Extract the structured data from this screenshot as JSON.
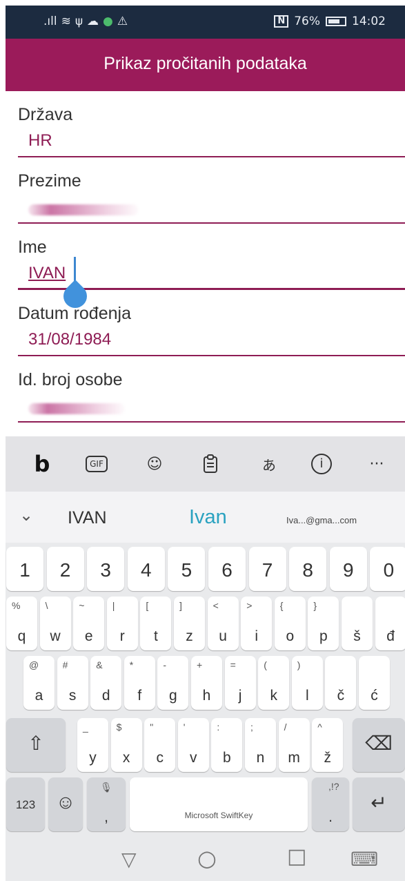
{
  "status_bar": {
    "signal": ".ıll",
    "wifi": "≋",
    "usb": "ψ",
    "cloud": "☁",
    "dot": "●",
    "warning": "⚠",
    "nfc": "N",
    "battery_percent": "76%",
    "time": "14:02"
  },
  "title": "Prikaz pročitanih podataka",
  "fields": [
    {
      "label": "Država",
      "value": "HR"
    },
    {
      "label": "Prezime",
      "value": ""
    },
    {
      "label": "Ime",
      "value": "IVAN"
    },
    {
      "label": "Datum rođenja",
      "value": "31/08/1984"
    },
    {
      "label": "Id. broj osobe",
      "value": ""
    }
  ],
  "keyboard": {
    "toolbar": {
      "bing": "b",
      "gif": "GIF",
      "sticker": "☺",
      "clipboard": "📋",
      "translate": "あ",
      "info": "i",
      "more": "···"
    },
    "suggestions": {
      "collapse": "⌄",
      "left": "IVAN",
      "center": "Ivan",
      "right": "Iva...@gma...com"
    },
    "number_row": [
      "1",
      "2",
      "3",
      "4",
      "5",
      "6",
      "7",
      "8",
      "9",
      "0"
    ],
    "row1": [
      {
        "main": "q",
        "sub": "%"
      },
      {
        "main": "w",
        "sub": "\\"
      },
      {
        "main": "e",
        "sub": "~"
      },
      {
        "main": "r",
        "sub": "|"
      },
      {
        "main": "t",
        "sub": "["
      },
      {
        "main": "z",
        "sub": "]"
      },
      {
        "main": "u",
        "sub": "<"
      },
      {
        "main": "i",
        "sub": ">"
      },
      {
        "main": "o",
        "sub": "{"
      },
      {
        "main": "p",
        "sub": "}"
      },
      {
        "main": "š",
        "sub": ""
      },
      {
        "main": "đ",
        "sub": ""
      }
    ],
    "row2": [
      {
        "main": "a",
        "sub": "@"
      },
      {
        "main": "s",
        "sub": "#"
      },
      {
        "main": "d",
        "sub": "&"
      },
      {
        "main": "f",
        "sub": "*"
      },
      {
        "main": "g",
        "sub": "-"
      },
      {
        "main": "h",
        "sub": "+"
      },
      {
        "main": "j",
        "sub": "="
      },
      {
        "main": "k",
        "sub": "("
      },
      {
        "main": "l",
        "sub": ")"
      },
      {
        "main": "č",
        "sub": ""
      },
      {
        "main": "ć",
        "sub": ""
      }
    ],
    "row3": [
      {
        "main": "y",
        "sub": "_"
      },
      {
        "main": "x",
        "sub": "$"
      },
      {
        "main": "c",
        "sub": "\""
      },
      {
        "main": "v",
        "sub": "'"
      },
      {
        "main": "b",
        "sub": ":"
      },
      {
        "main": "n",
        "sub": ";"
      },
      {
        "main": "m",
        "sub": "/"
      },
      {
        "main": "ž",
        "sub": "^"
      }
    ],
    "shift": "⇧",
    "backspace": "⌫",
    "numbers_key": "123",
    "emoji": "☺",
    "mic_comma": ",",
    "mic": "🎙",
    "space_label": "Microsoft SwiftKey",
    "period": ".",
    "period_sub": ",!?",
    "enter": "↵"
  },
  "nav": {
    "back": "▽",
    "home": "○",
    "recents": "□",
    "keyboard": "⌨"
  },
  "colors": {
    "accent": "#9b1b5a",
    "status_bar": "#1c2b40",
    "cursor": "#4192dc",
    "suggestion_highlight": "#2aa2c0"
  }
}
